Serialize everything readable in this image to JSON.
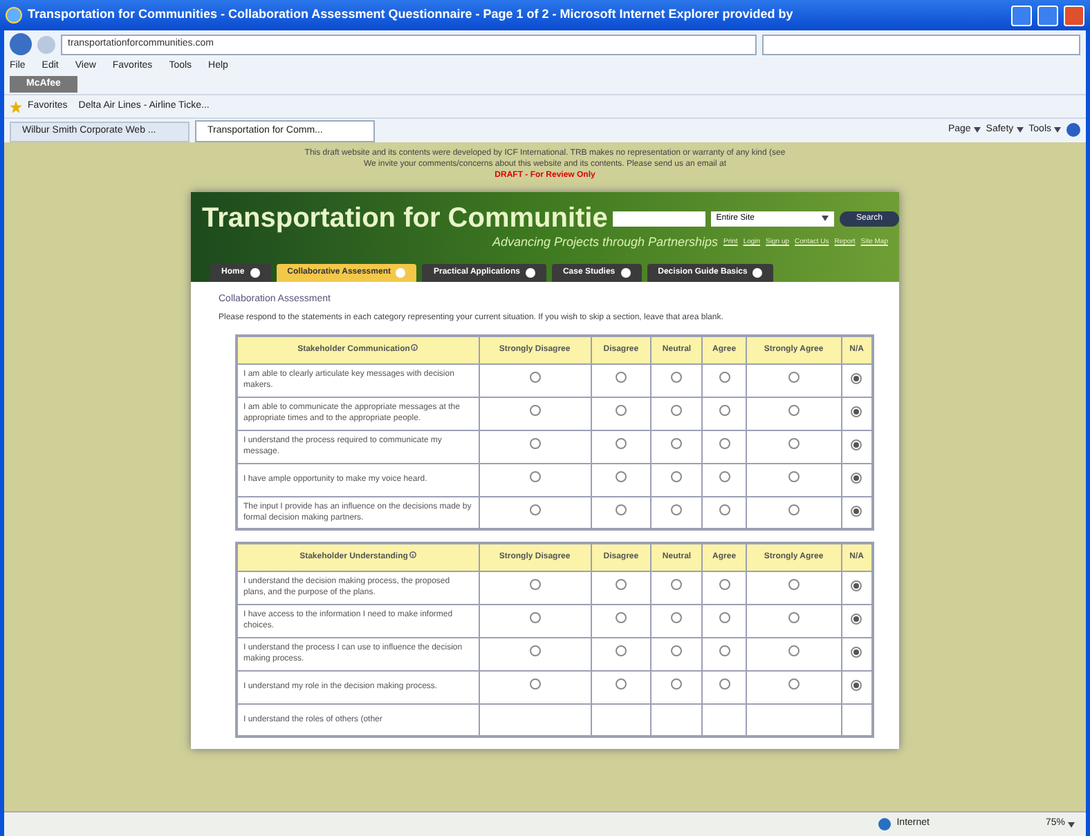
{
  "window": {
    "title": "Transportation for Communities - Collaboration Assessment Questionnaire - Page 1 of 2 - Microsoft Internet Explorer provided by"
  },
  "address_bar": {
    "url": "transportationforcommunities.com"
  },
  "menu": [
    "File",
    "Edit",
    "View",
    "Favorites",
    "Tools",
    "Help"
  ],
  "toolbar": {
    "mcafee": "McAfee"
  },
  "favorites_bar": {
    "label": "Favorites",
    "items": [
      "Delta Air Lines - Airline Ticke..."
    ]
  },
  "browser_tabs": [
    {
      "label": "Wilbur Smith Corporate Web ...",
      "selected": false
    },
    {
      "label": "Transportation for Comm...",
      "selected": true
    }
  ],
  "command_bar": [
    "Page",
    "Safety",
    "Tools"
  ],
  "notice": {
    "lines": [
      "This draft website and its contents were developed by ICF International. TRB makes no representation or warranty of any kind (see",
      "We invite your comments/concerns about this website and its contents. Please send us an email at"
    ],
    "draft": "DRAFT - For Review Only"
  },
  "site": {
    "title": "Transportation for Communitie",
    "tagline": "Advancing Projects through Partnerships",
    "scope": "Entire Site",
    "search_button": "Search",
    "links": [
      "Print",
      "Login",
      "Sign up",
      "Contact Us",
      "Report",
      "Site Map"
    ]
  },
  "nav": [
    {
      "label": "Home",
      "selected": false
    },
    {
      "label": "Collaborative Assessment",
      "selected": true
    },
    {
      "label": "Practical Applications",
      "selected": false
    },
    {
      "label": "Case Studies",
      "selected": false
    },
    {
      "label": "Decision Guide Basics",
      "selected": false
    }
  ],
  "section_title": "Collaboration Assessment",
  "instructions": "Please respond to the statements in each category representing your current situation. If you wish to skip a section, leave that area blank.",
  "tables": [
    {
      "title": "Stakeholder Communication",
      "columns": [
        "Strongly Disagree",
        "Disagree",
        "Neutral",
        "Agree",
        "Strongly Agree",
        "N/A"
      ],
      "rows": [
        {
          "statement": "I am able to clearly articulate key messages with decision makers.",
          "choices": [
            {
              "selected": false
            },
            {
              "selected": false
            },
            {
              "selected": false
            },
            {
              "selected": false
            },
            {
              "selected": false
            },
            {
              "selected": true
            }
          ]
        },
        {
          "statement": "I am able to communicate the appropriate messages at the appropriate times and to the appropriate people.",
          "choices": [
            {
              "selected": false
            },
            {
              "selected": false
            },
            {
              "selected": false
            },
            {
              "selected": false
            },
            {
              "selected": false
            },
            {
              "selected": true
            }
          ]
        },
        {
          "statement": "I understand the process required to communicate my message.",
          "choices": [
            {
              "selected": false
            },
            {
              "selected": false
            },
            {
              "selected": false
            },
            {
              "selected": false
            },
            {
              "selected": false
            },
            {
              "selected": true
            }
          ]
        },
        {
          "statement": "I have ample opportunity to make my voice heard.",
          "choices": [
            {
              "selected": false
            },
            {
              "selected": false
            },
            {
              "selected": false
            },
            {
              "selected": false
            },
            {
              "selected": false
            },
            {
              "selected": true
            }
          ]
        },
        {
          "statement": "The input I provide has an influence on the decisions made by formal decision making partners.",
          "choices": [
            {
              "selected": false
            },
            {
              "selected": false
            },
            {
              "selected": false
            },
            {
              "selected": false
            },
            {
              "selected": false
            },
            {
              "selected": true
            }
          ]
        }
      ]
    },
    {
      "title": "Stakeholder Understanding",
      "columns": [
        "Strongly Disagree",
        "Disagree",
        "Neutral",
        "Agree",
        "Strongly Agree",
        "N/A"
      ],
      "rows": [
        {
          "statement": "I understand the decision making process, the proposed plans, and the purpose of the plans.",
          "choices": [
            {
              "selected": false
            },
            {
              "selected": false
            },
            {
              "selected": false
            },
            {
              "selected": false
            },
            {
              "selected": false
            },
            {
              "selected": true
            }
          ]
        },
        {
          "statement": "I have access to the information I need to make informed choices.",
          "choices": [
            {
              "selected": false
            },
            {
              "selected": false
            },
            {
              "selected": false
            },
            {
              "selected": false
            },
            {
              "selected": false
            },
            {
              "selected": true
            }
          ]
        },
        {
          "statement": "I understand the process I can use to influence the decision making process.",
          "choices": [
            {
              "selected": false
            },
            {
              "selected": false
            },
            {
              "selected": false
            },
            {
              "selected": false
            },
            {
              "selected": false
            },
            {
              "selected": true
            }
          ]
        },
        {
          "statement": "I understand my role in the decision making process.",
          "choices": [
            {
              "selected": false
            },
            {
              "selected": false
            },
            {
              "selected": false
            },
            {
              "selected": false
            },
            {
              "selected": false
            },
            {
              "selected": true
            }
          ]
        },
        {
          "statement": "I understand the roles of others (other"
        }
      ]
    }
  ],
  "status_bar": {
    "zone": "Internet",
    "zoom": "75%"
  }
}
